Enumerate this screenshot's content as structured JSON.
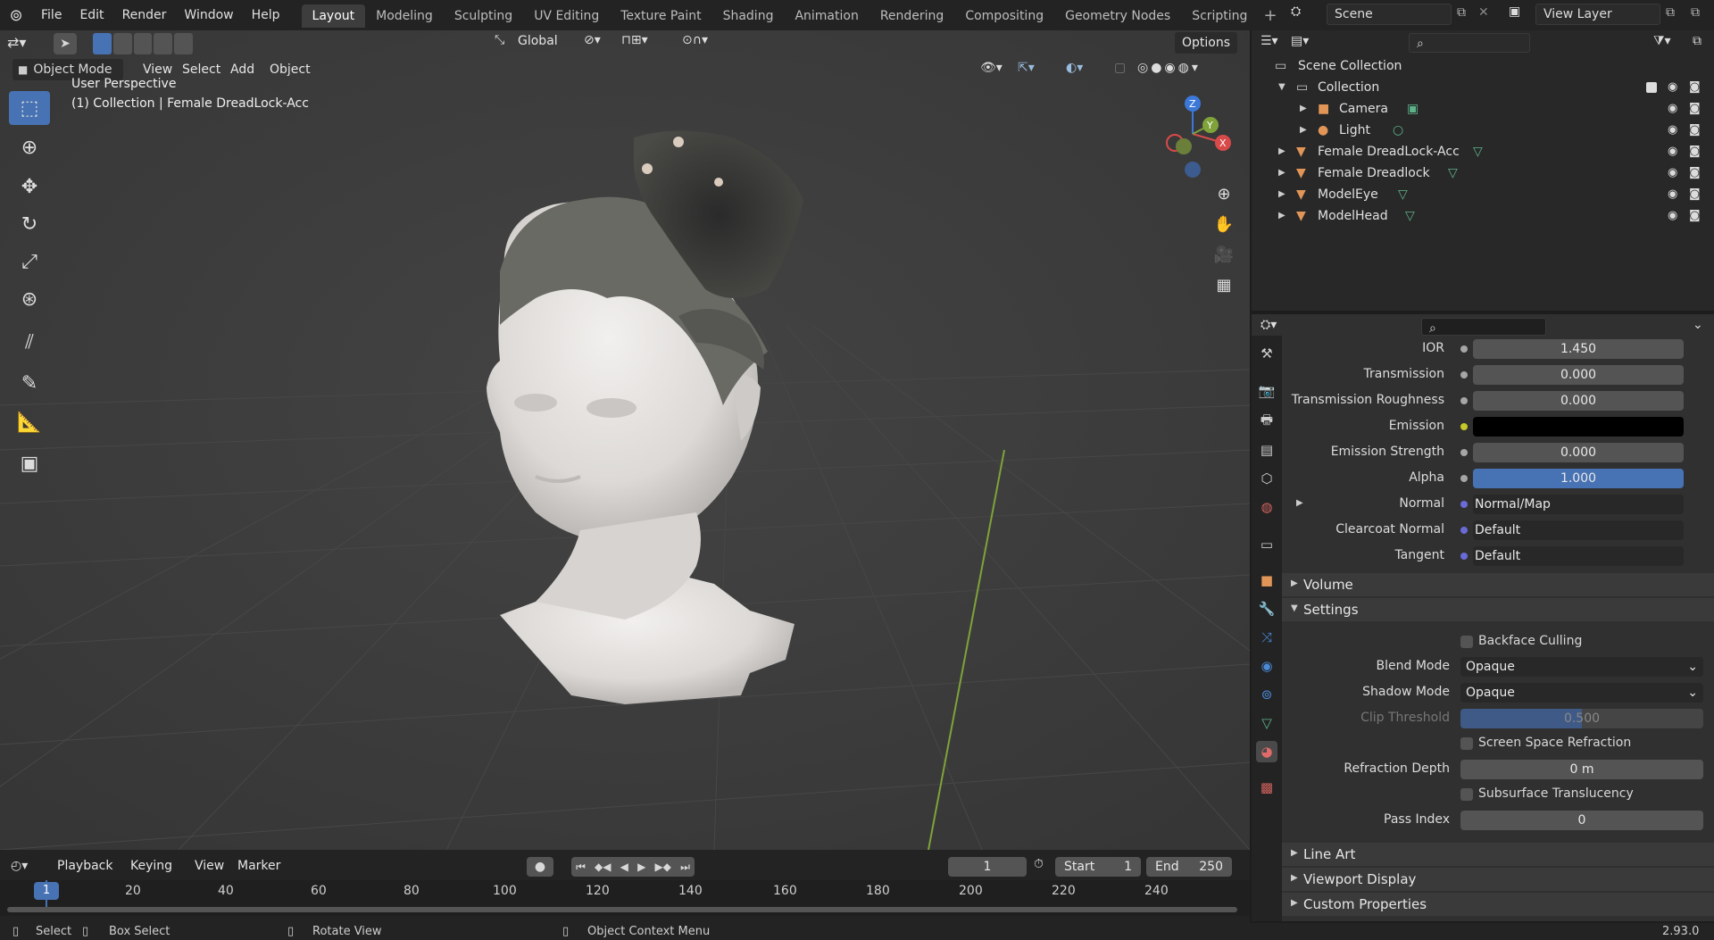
{
  "menus": [
    "File",
    "Edit",
    "Render",
    "Window",
    "Help"
  ],
  "workspaces": [
    {
      "label": "Layout",
      "active": true
    },
    {
      "label": "Modeling"
    },
    {
      "label": "Sculpting"
    },
    {
      "label": "UV Editing"
    },
    {
      "label": "Texture Paint"
    },
    {
      "label": "Shading"
    },
    {
      "label": "Animation"
    },
    {
      "label": "Rendering"
    },
    {
      "label": "Compositing"
    },
    {
      "label": "Geometry Nodes"
    },
    {
      "label": "Scripting"
    }
  ],
  "scene": {
    "label": "Scene"
  },
  "view_layer": {
    "label": "View Layer"
  },
  "viewport_header": {
    "transform_orientation": "Global",
    "options": "Options",
    "mode": "Object Mode",
    "menus": [
      "View",
      "Select",
      "Add",
      "Object"
    ]
  },
  "viewport": {
    "overlay_line1": "User Perspective",
    "overlay_line2": "(1) Collection | Female DreadLock-Acc",
    "gizmo_axes": {
      "x": "X",
      "y": "Y",
      "z": "Z"
    }
  },
  "outliner": {
    "root": "Scene Collection",
    "collection": "Collection",
    "items": [
      "Camera",
      "Light",
      "Female DreadLock-Acc",
      "Female Dreadlock",
      "ModelEye",
      "ModelHead"
    ]
  },
  "properties": {
    "rows": [
      {
        "label": "IOR",
        "value": "1.450"
      },
      {
        "label": "Transmission",
        "value": "0.000"
      },
      {
        "label": "Transmission Roughness",
        "value": "0.000"
      },
      {
        "label": "Emission",
        "value": ""
      },
      {
        "label": "Emission Strength",
        "value": "0.000"
      },
      {
        "label": "Alpha",
        "value": "1.000"
      },
      {
        "label": "Normal",
        "value": "Normal/Map"
      },
      {
        "label": "Clearcoat Normal",
        "value": "Default"
      },
      {
        "label": "Tangent",
        "value": "Default"
      }
    ],
    "sections": {
      "volume": "Volume",
      "settings": "Settings",
      "line_art": "Line Art",
      "viewport_display": "Viewport Display",
      "custom_properties": "Custom Properties"
    },
    "settings": {
      "backface_culling": "Backface Culling",
      "blend_mode_label": "Blend Mode",
      "blend_mode": "Opaque",
      "shadow_mode_label": "Shadow Mode",
      "shadow_mode": "Opaque",
      "clip_threshold_label": "Clip Threshold",
      "clip_threshold": "0.500",
      "ssr": "Screen Space Refraction",
      "refraction_depth_label": "Refraction Depth",
      "refraction_depth": "0 m",
      "subsurface": "Subsurface Translucency",
      "pass_index_label": "Pass Index",
      "pass_index": "0"
    }
  },
  "timeline": {
    "menus": [
      "Playback",
      "Keying",
      "View",
      "Marker"
    ],
    "current_frame": "1",
    "start_label": "Start",
    "start": "1",
    "end_label": "End",
    "end": "250",
    "ticks": [
      "20",
      "40",
      "60",
      "80",
      "100",
      "120",
      "140",
      "160",
      "180",
      "200",
      "220",
      "240"
    ],
    "playhead": "1"
  },
  "status": {
    "select": "Select",
    "box_select": "Box Select",
    "rotate_view": "Rotate View",
    "context_menu": "Object Context Menu",
    "version": "2.93.0"
  },
  "colors": {
    "accent": "#4772b3",
    "alpha_bar": "#4772b3",
    "emission": "#000000"
  }
}
